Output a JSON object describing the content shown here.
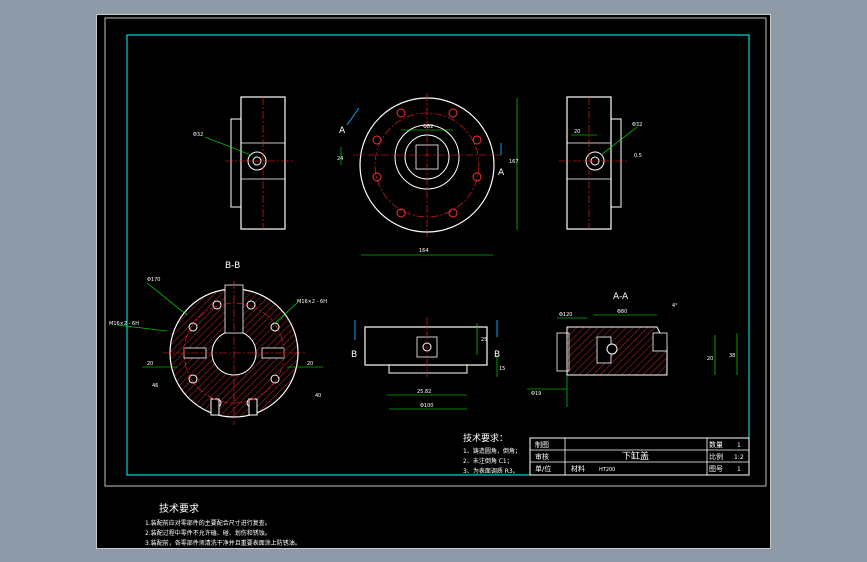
{
  "colors": {
    "background": "#8e9aa8",
    "sheet": "#000000",
    "frame": "#00ffff",
    "outline": "#ffffff",
    "center_line": "#ff2020",
    "dimension": "#00ff00",
    "hatch": "#ff3030",
    "arrow": "#00aaff",
    "text": "#ffffff"
  },
  "views": {
    "front_section": {
      "label": "B-B",
      "dims": [
        "Φ170",
        "M16×2 - 6H",
        "M16×2 - 6H",
        "20",
        "20",
        "46",
        "40"
      ]
    },
    "top_view": {
      "dims": [
        "Φ82",
        "24",
        "167",
        "164"
      ],
      "section_mark": "A"
    },
    "left_side": {
      "dims": [
        "Φ32"
      ]
    },
    "right_side": {
      "dims": [
        "20",
        "Φ32",
        "0.5"
      ]
    },
    "bottom_view": {
      "dims": [
        "25.82",
        "Φ100",
        "25",
        "15"
      ],
      "section_mark": "B"
    },
    "section_aa": {
      "label": "A-A",
      "dims": [
        "Φ80",
        "4°",
        "Φ120",
        "20",
        "38",
        "Φ19"
      ]
    }
  },
  "tech_req_small": {
    "heading": "技术要求：",
    "lines": [
      "1、铸造圆角，倒角；",
      "2、未注倒角 C1；",
      "3、为表面调质 R3。"
    ]
  },
  "title_block": {
    "draw": "制图",
    "check": "审核",
    "unit": "单/位",
    "part_name": "下缸盖",
    "material_label": "材料",
    "material": "HT200",
    "qty_label": "数量",
    "qty": "1",
    "scale_label": "比例",
    "scale": "1:2",
    "drawing_no_label": "图号",
    "drawing_no": "1"
  },
  "tech_req_large": {
    "heading": "技术要求",
    "lines": [
      "1.装配前应对零部件的主要配合尺寸进行复查。",
      "2.装配过程中零件不允许磕、碰、划伤和锈蚀。",
      "3.装配前，各零部件须清洗干净并且重要表面涂上防锈油。"
    ]
  }
}
